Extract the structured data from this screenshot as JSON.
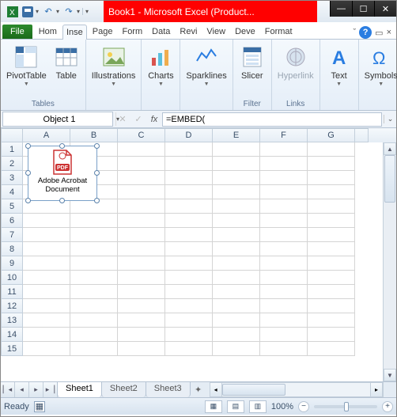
{
  "titlebar": {
    "title": "Book1 - Microsoft Excel (Product..."
  },
  "qat_icons": [
    "excel-icon",
    "save-icon",
    "undo-icon",
    "redo-icon"
  ],
  "tabs": {
    "file": "File",
    "items": [
      "Hom",
      "Inse",
      "Page",
      "Form",
      "Data",
      "Revi",
      "View",
      "Deve",
      "Format"
    ],
    "active_index": 1
  },
  "ribbon": {
    "groups": [
      {
        "label": "Tables",
        "buttons": [
          {
            "name": "pivottable-button",
            "label": "PivotTable",
            "icon": "pivot",
            "dd": true
          },
          {
            "name": "table-button",
            "label": "Table",
            "icon": "table"
          }
        ]
      },
      {
        "label": "",
        "buttons": [
          {
            "name": "illustrations-button",
            "label": "Illustrations",
            "icon": "picture",
            "dd": true
          }
        ]
      },
      {
        "label": "",
        "buttons": [
          {
            "name": "charts-button",
            "label": "Charts",
            "icon": "chart",
            "dd": true
          }
        ]
      },
      {
        "label": "",
        "buttons": [
          {
            "name": "sparklines-button",
            "label": "Sparklines",
            "icon": "spark",
            "dd": true
          }
        ]
      },
      {
        "label": "Filter",
        "buttons": [
          {
            "name": "slicer-button",
            "label": "Slicer",
            "icon": "slicer"
          }
        ]
      },
      {
        "label": "Links",
        "buttons": [
          {
            "name": "hyperlink-button",
            "label": "Hyperlink",
            "icon": "link",
            "disabled": true
          }
        ]
      },
      {
        "label": "",
        "buttons": [
          {
            "name": "text-button",
            "label": "Text",
            "icon": "textA",
            "dd": true
          }
        ]
      },
      {
        "label": "",
        "buttons": [
          {
            "name": "symbols-button",
            "label": "Symbols",
            "icon": "omega",
            "dd": true
          }
        ]
      }
    ]
  },
  "formula_bar": {
    "name_box": "Object 1",
    "formula": "=EMBED("
  },
  "columns": [
    "A",
    "B",
    "C",
    "D",
    "E",
    "F",
    "G"
  ],
  "row_count": 15,
  "embedded_object": {
    "label_line1": "Adobe Acrobat",
    "label_line2": "Document",
    "badge": "PDF"
  },
  "sheets": {
    "items": [
      "Sheet1",
      "Sheet2",
      "Sheet3"
    ],
    "active_index": 0
  },
  "status": {
    "left": "Ready",
    "macro_icon": true,
    "zoom_label": "100%"
  }
}
